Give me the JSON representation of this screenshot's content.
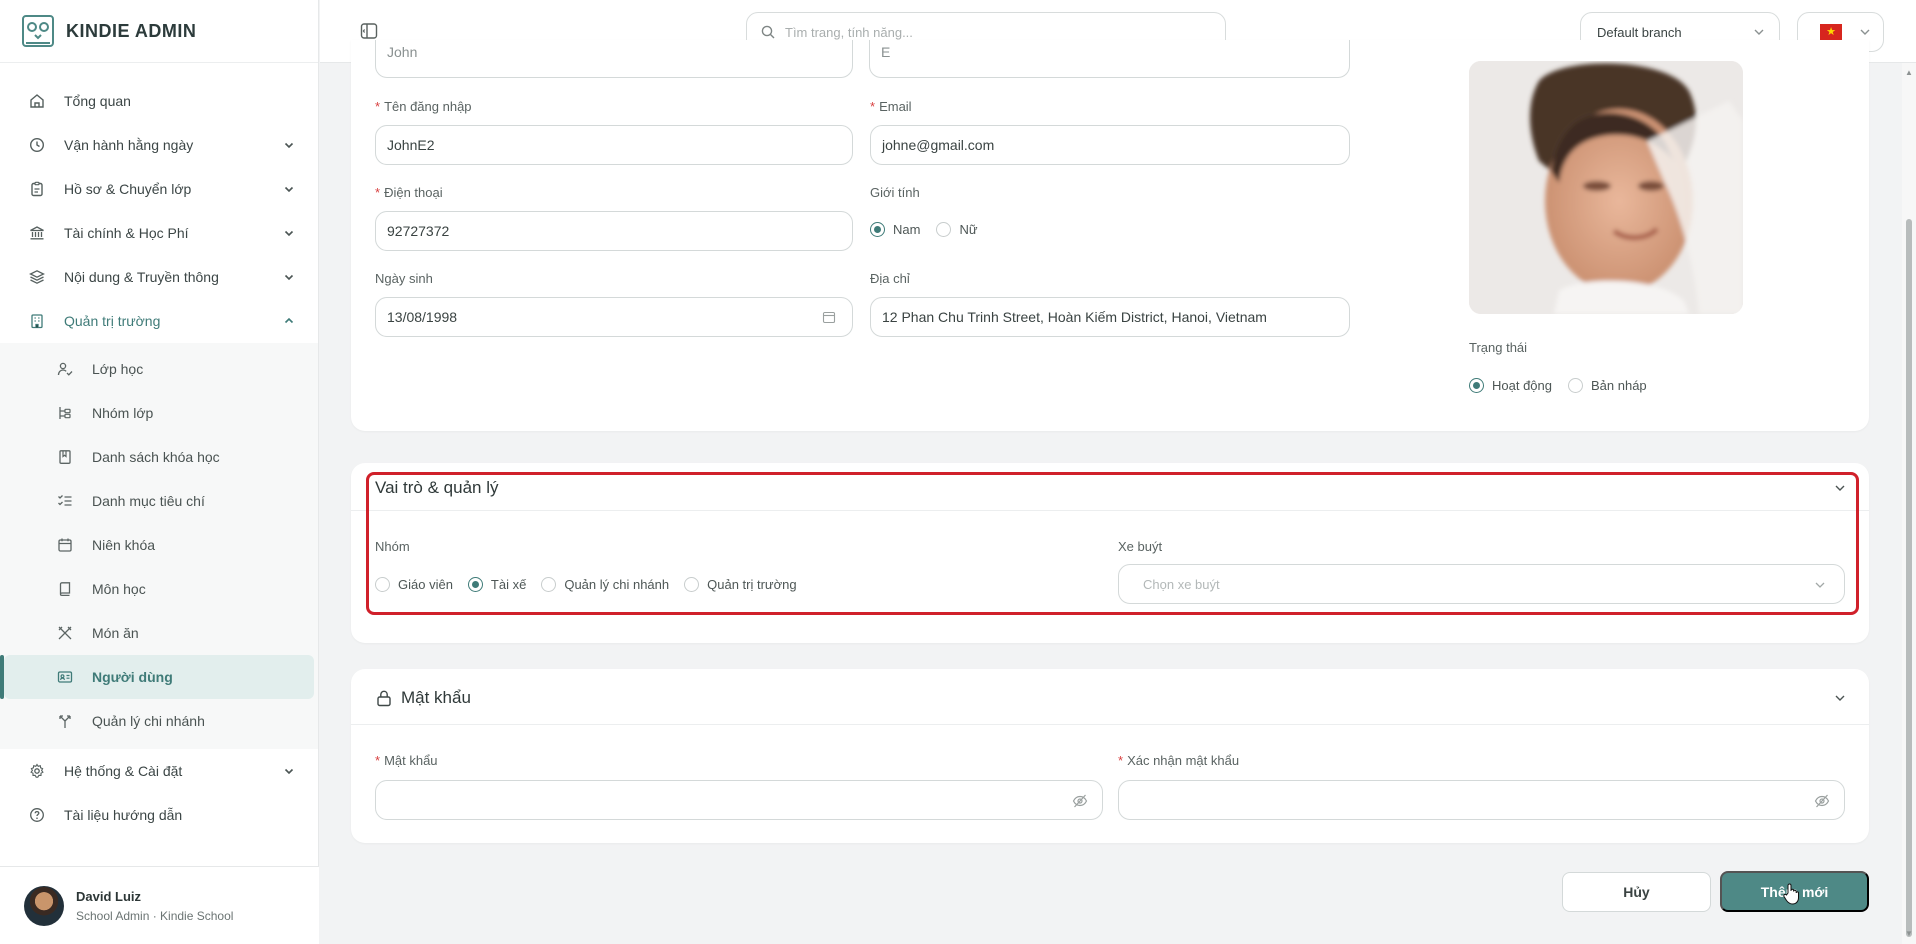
{
  "brand": {
    "name": "KINDIE ADMIN"
  },
  "topbar": {
    "search_placeholder": "Tìm trang, tính năng...",
    "branch": "Default branch",
    "language_flag": "vn-flag"
  },
  "sidebar": {
    "items": [
      {
        "label": "Tổng quan",
        "icon": "home-icon"
      },
      {
        "label": "Vận hành hằng ngày",
        "icon": "clock-icon"
      },
      {
        "label": "Hồ sơ & Chuyển lớp",
        "icon": "clipboard-icon"
      },
      {
        "label": "Tài chính & Học Phí",
        "icon": "bank-icon"
      },
      {
        "label": "Nội dung & Truyền thông",
        "icon": "layers-icon"
      },
      {
        "label": "Quản trị trường",
        "icon": "building-icon"
      }
    ],
    "sub_items": [
      {
        "label": "Lớp học",
        "icon": "user-check-icon"
      },
      {
        "label": "Nhóm lớp",
        "icon": "group-icon"
      },
      {
        "label": "Danh sách khóa học",
        "icon": "bookmark-icon"
      },
      {
        "label": "Danh mục tiêu chí",
        "icon": "checklist-icon"
      },
      {
        "label": "Niên khóa",
        "icon": "calendar-icon"
      },
      {
        "label": "Môn học",
        "icon": "book-icon"
      },
      {
        "label": "Món ăn",
        "icon": "utensils-icon"
      },
      {
        "label": "Người dùng",
        "icon": "id-card-icon"
      },
      {
        "label": "Quản lý chi nhánh",
        "icon": "branch-icon"
      }
    ],
    "bottom_items": [
      {
        "label": "Hệ thống & Cài đặt",
        "icon": "gear-icon"
      },
      {
        "label": "Tài liệu hướng dẫn",
        "icon": "help-icon"
      }
    ],
    "user": {
      "name": "David Luiz",
      "role": "School Admin · Kindie School"
    }
  },
  "form": {
    "username_label": "Tên đăng nhập",
    "username_value": "JohnE2",
    "email_label": "Email",
    "email_value": "johne@gmail.com",
    "phone_label": "Điện thoại",
    "phone_value": "92727372",
    "gender_label": "Giới tính",
    "gender_options": [
      "Nam",
      "Nữ"
    ],
    "gender_selected": "Nam",
    "dob_label": "Ngày sinh",
    "dob_value": "13/08/1998",
    "address_label": "Địa chỉ",
    "address_value": "12 Phan Chu Trinh Street, Hoàn Kiếm District, Hanoi, Vietnam",
    "status_label": "Trạng thái",
    "status_options": [
      "Hoạt động",
      "Bản nháp"
    ],
    "status_selected": "Hoạt động",
    "top_input_left": "John",
    "top_input_right": "E"
  },
  "roles": {
    "title": "Vai trò & quản lý",
    "group_label": "Nhóm",
    "group_options": [
      "Giáo viên",
      "Tài xế",
      "Quản lý chi nhánh",
      "Quản trị trường"
    ],
    "group_selected": "Tài xế",
    "bus_label": "Xe buýt",
    "bus_placeholder": "Chọn xe buýt"
  },
  "password": {
    "title": "Mật khẩu",
    "password_label": "Mật khẩu",
    "confirm_label": "Xác nhận mật khẩu"
  },
  "actions": {
    "cancel": "Hủy",
    "submit": "Thêm mới"
  },
  "colors": {
    "accent": "#3f7b78",
    "primary_button": "#4e8986",
    "required": "#d84040",
    "highlight": "#d0202a"
  }
}
